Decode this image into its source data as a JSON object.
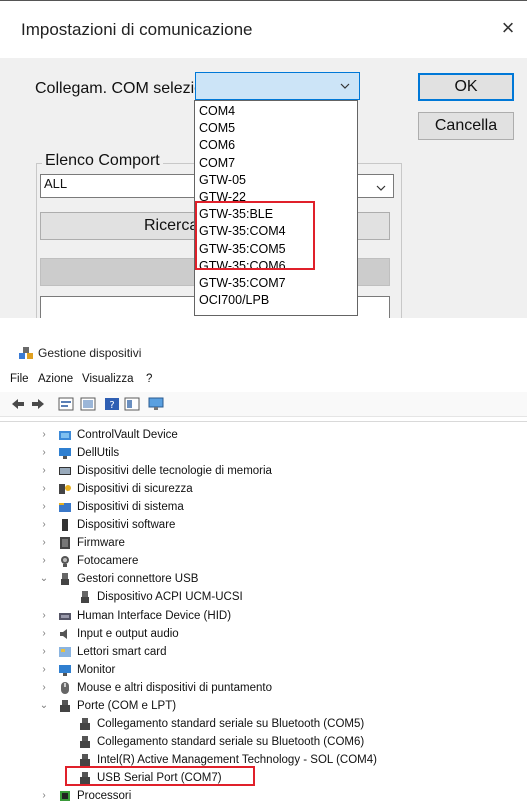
{
  "dialog": {
    "title": "Impostazioni di comunicazione",
    "close_symbol": "×",
    "com_label": "Collegam. COM selezionato",
    "ok_label": "OK",
    "cancel_label": "Cancella",
    "group_label": "Elenco Comport",
    "port_value": "ALL",
    "search_label": "Ricerca",
    "dropdown_items": [
      "COM4",
      "COM5",
      "COM6",
      "COM7",
      "GTW-05",
      "GTW-22",
      "GTW-35:BLE",
      "GTW-35:COM4",
      "GTW-35:COM5",
      "GTW-35:COM6",
      "GTW-35:COM7",
      "OCI700/LPB"
    ]
  },
  "device_manager": {
    "title": "Gestione dispositivi",
    "menu": [
      "File",
      "Azione",
      "Visualizza",
      "?"
    ],
    "toolbar_icons": [
      "back-icon",
      "forward-icon",
      "properties-icon",
      "update-icon",
      "help-icon",
      "scan-icon",
      "monitor-icon"
    ],
    "tree": [
      {
        "label": "ControlVault Device",
        "icon": "controlvault-icon",
        "expanded": false
      },
      {
        "label": "DellUtils",
        "icon": "monitor-device-icon",
        "expanded": false
      },
      {
        "label": "Dispositivi delle tecnologie di memoria",
        "icon": "memory-icon",
        "expanded": false
      },
      {
        "label": "Dispositivi di sicurezza",
        "icon": "security-device-icon",
        "expanded": false
      },
      {
        "label": "Dispositivi di sistema",
        "icon": "system-folder-icon",
        "expanded": false
      },
      {
        "label": "Dispositivi software",
        "icon": "software-device-icon",
        "expanded": false
      },
      {
        "label": "Firmware",
        "icon": "firmware-icon",
        "expanded": false
      },
      {
        "label": "Fotocamere",
        "icon": "camera-icon",
        "expanded": false
      },
      {
        "label": "Gestori connettore USB",
        "icon": "usb-connector-icon",
        "expanded": true
      },
      {
        "label": "Dispositivo ACPI UCM-UCSI",
        "icon": "usb-connector-icon",
        "child": true
      },
      {
        "label": "Human Interface Device (HID)",
        "icon": "hid-icon",
        "expanded": false
      },
      {
        "label": "Input e output audio",
        "icon": "audio-icon",
        "expanded": false
      },
      {
        "label": "Lettori smart card",
        "icon": "smartcard-icon",
        "expanded": false
      },
      {
        "label": "Monitor",
        "icon": "monitor-device-icon",
        "expanded": false
      },
      {
        "label": "Mouse e altri dispositivi di puntamento",
        "icon": "mouse-icon",
        "expanded": false
      },
      {
        "label": "Porte (COM e LPT)",
        "icon": "port-icon",
        "expanded": true
      },
      {
        "label": "Collegamento standard seriale su Bluetooth (COM5)",
        "icon": "port-icon",
        "child": true
      },
      {
        "label": "Collegamento standard seriale su Bluetooth (COM6)",
        "icon": "port-icon",
        "child": true
      },
      {
        "label": "Intel(R) Active Management Technology - SOL (COM4)",
        "icon": "port-icon",
        "child": true
      },
      {
        "label": "USB Serial Port (COM7)",
        "icon": "port-icon",
        "child": true
      },
      {
        "label": "Processori",
        "icon": "processor-icon",
        "expanded": false
      }
    ]
  }
}
